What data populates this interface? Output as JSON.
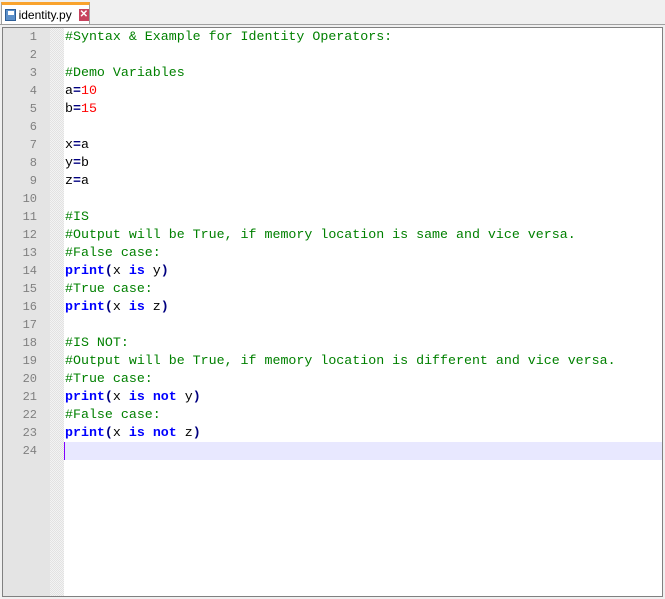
{
  "tab": {
    "title": "identity.py",
    "icon": "save-icon",
    "close_icon": "close-icon",
    "close_glyph": "✕"
  },
  "colors": {
    "comment": "#008000",
    "number": "#ff0000",
    "keyword": "#0000ff",
    "current_line": "#e8e8ff"
  },
  "current_line": 24,
  "lines": [
    [
      [
        "cm",
        "#Syntax & Example for Identity Operators:"
      ]
    ],
    [],
    [
      [
        "cm",
        "#Demo Variables"
      ]
    ],
    [
      [
        "id",
        "a"
      ],
      [
        "op",
        "="
      ],
      [
        "num",
        "10"
      ]
    ],
    [
      [
        "id",
        "b"
      ],
      [
        "op",
        "="
      ],
      [
        "num",
        "15"
      ]
    ],
    [],
    [
      [
        "id",
        "x"
      ],
      [
        "op",
        "="
      ],
      [
        "id",
        "a"
      ]
    ],
    [
      [
        "id",
        "y"
      ],
      [
        "op",
        "="
      ],
      [
        "id",
        "b"
      ]
    ],
    [
      [
        "id",
        "z"
      ],
      [
        "op",
        "="
      ],
      [
        "id",
        "a"
      ]
    ],
    [],
    [
      [
        "cm",
        "#IS"
      ]
    ],
    [
      [
        "cm",
        "#Output will be True, if memory location is same and vice versa."
      ]
    ],
    [
      [
        "cm",
        "#False case:"
      ]
    ],
    [
      [
        "kw",
        "print"
      ],
      [
        "op",
        "("
      ],
      [
        "id",
        "x "
      ],
      [
        "kw",
        "is"
      ],
      [
        "id",
        " y"
      ],
      [
        "op",
        ")"
      ]
    ],
    [
      [
        "cm",
        "#True case:"
      ]
    ],
    [
      [
        "kw",
        "print"
      ],
      [
        "op",
        "("
      ],
      [
        "id",
        "x "
      ],
      [
        "kw",
        "is"
      ],
      [
        "id",
        " z"
      ],
      [
        "op",
        ")"
      ]
    ],
    [],
    [
      [
        "cm",
        "#IS NOT:"
      ]
    ],
    [
      [
        "cm",
        "#Output will be True, if memory location is different and vice versa."
      ]
    ],
    [
      [
        "cm",
        "#True case:"
      ]
    ],
    [
      [
        "kw",
        "print"
      ],
      [
        "op",
        "("
      ],
      [
        "id",
        "x "
      ],
      [
        "kw",
        "is"
      ],
      [
        "id",
        " "
      ],
      [
        "kw",
        "not"
      ],
      [
        "id",
        " y"
      ],
      [
        "op",
        ")"
      ]
    ],
    [
      [
        "cm",
        "#False case:"
      ]
    ],
    [
      [
        "kw",
        "print"
      ],
      [
        "op",
        "("
      ],
      [
        "id",
        "x "
      ],
      [
        "kw",
        "is"
      ],
      [
        "id",
        " "
      ],
      [
        "kw",
        "not"
      ],
      [
        "id",
        " z"
      ],
      [
        "op",
        ")"
      ]
    ],
    []
  ]
}
